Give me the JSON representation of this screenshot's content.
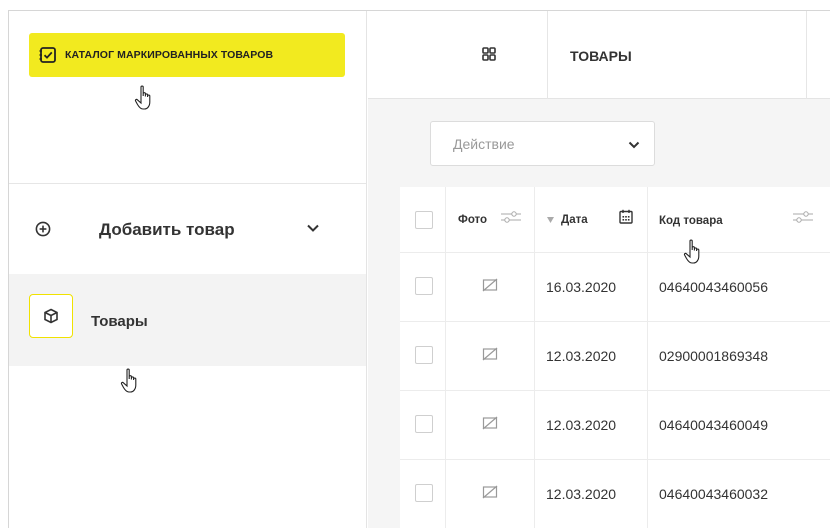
{
  "sidebar": {
    "brand_label": "КАТАЛОГ МАРКИРОВАННЫХ ТОВАРОВ",
    "add_label": "Добавить товар",
    "goods_label": "Товары"
  },
  "header": {
    "title": "ТОВАРЫ"
  },
  "action": {
    "placeholder": "Действие"
  },
  "table": {
    "columns": [
      "Фото",
      "Дата",
      "Код товара"
    ],
    "rows": [
      {
        "date": "16.03.2020",
        "code": "04640043460056"
      },
      {
        "date": "12.03.2020",
        "code": "02900001869348"
      },
      {
        "date": "12.03.2020",
        "code": "04640043460049"
      },
      {
        "date": "12.03.2020",
        "code": "04640043460032"
      }
    ]
  },
  "colors": {
    "accent": "#f2ea1f",
    "sidebar_active_bg": "#f3f3f3",
    "main_bg": "#f5f5f5"
  },
  "icons": [
    "checklist-icon",
    "plus-circle-icon",
    "chevron-down-icon",
    "box-icon",
    "grid-icon",
    "filter-sliders-icon",
    "sort-down-icon",
    "calendar-icon",
    "no-photo-icon",
    "hand-cursor-icon"
  ]
}
